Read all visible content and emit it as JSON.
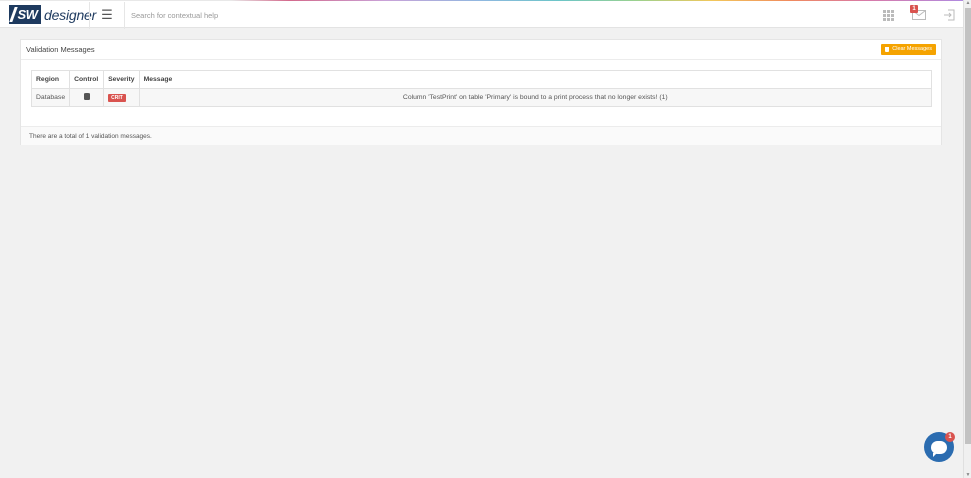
{
  "app": {
    "logo_mark": "SW",
    "logo_text": "designer"
  },
  "topbar": {
    "search_placeholder": "Search for contextual help",
    "notification_count": "1",
    "icons": [
      "menu-icon",
      "apps-grid-icon",
      "messages-icon",
      "logout-icon"
    ]
  },
  "panel": {
    "title": "Validation Messages",
    "clear_button_label": "Clear Messages",
    "columns": [
      "Region",
      "Control",
      "Severity",
      "Message"
    ],
    "rows": [
      {
        "region": "Database",
        "control_icon": "database-icon",
        "severity": "CRIT",
        "message": "Column 'TestPrint' on table 'Primary' is bound to a print process that no longer exists! (1)"
      }
    ],
    "footer_text": "There are a total of 1 validation messages."
  },
  "chat": {
    "badge_count": "1"
  },
  "colors": {
    "brand": "#1e3a5f",
    "warning_button": "#f5a300",
    "critical": "#d9534f",
    "chat": "#2b6cb0",
    "background": "#f1f1f1"
  }
}
